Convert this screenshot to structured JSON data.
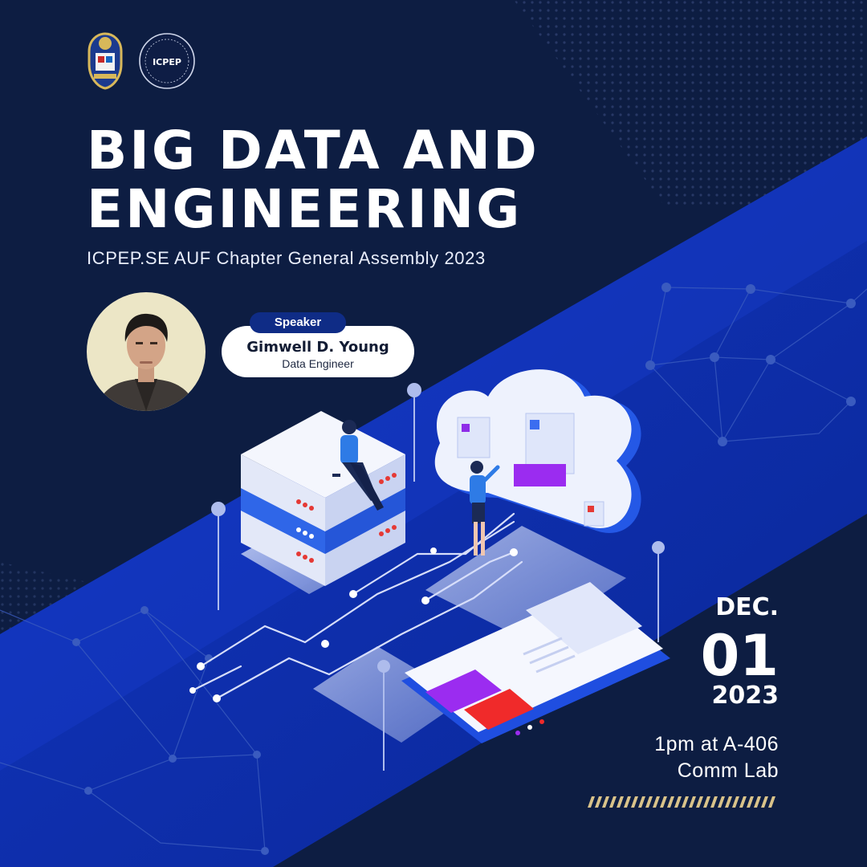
{
  "title": {
    "line1": "BIG DATA AND",
    "line2": "ENGINEERING"
  },
  "subtitle": "ICPEP.SE AUF Chapter General Assembly 2023",
  "logos": {
    "left": {
      "icon": "university-seal-icon"
    },
    "right": {
      "icon": "icpep-logo-icon",
      "text": "ICPEP"
    }
  },
  "speaker": {
    "tag": "Speaker",
    "name": "Gimwell D. Young",
    "role": "Data Engineer"
  },
  "event": {
    "month": "DEC.",
    "day": "01",
    "year": "2023",
    "time_place": "1pm at A-406",
    "venue": "Comm Lab"
  },
  "colors": {
    "background": "#0d1d42",
    "band": "#1233b8",
    "accent_purple": "#9b2cf0",
    "accent_red": "#f02a2a",
    "stripe_gold": "#d9c38a"
  }
}
